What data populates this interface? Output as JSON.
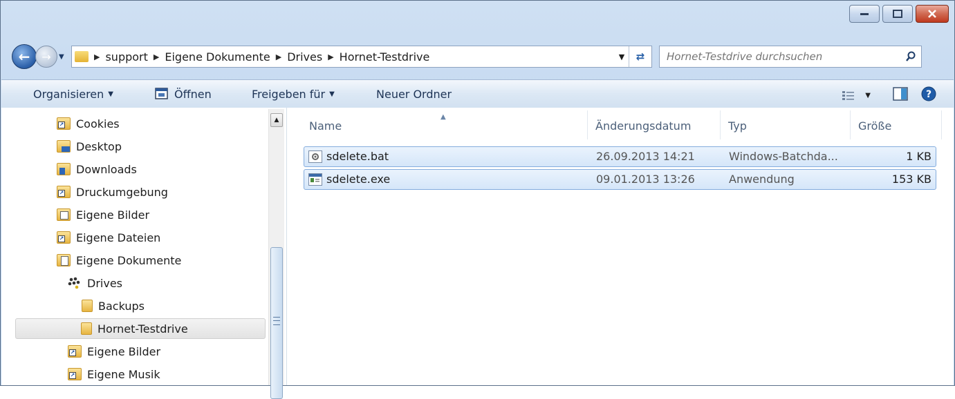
{
  "address": {
    "crumbs": [
      "support",
      "Eigene Dokumente",
      "Drives",
      "Hornet-Testdrive"
    ]
  },
  "search": {
    "placeholder": "Hornet-Testdrive durchsuchen"
  },
  "toolbar": {
    "organize": "Organisieren",
    "open": "Öffnen",
    "share": "Freigeben für",
    "new_folder": "Neuer Ordner"
  },
  "tree": [
    {
      "label": "Cookies"
    },
    {
      "label": "Desktop"
    },
    {
      "label": "Downloads"
    },
    {
      "label": "Druckumgebung"
    },
    {
      "label": "Eigene Bilder"
    },
    {
      "label": "Eigene Dateien"
    },
    {
      "label": "Eigene Dokumente"
    },
    {
      "label": "Drives"
    },
    {
      "label": "Backups"
    },
    {
      "label": "Hornet-Testdrive"
    },
    {
      "label": "Eigene Bilder"
    },
    {
      "label": "Eigene Musik"
    }
  ],
  "columns": {
    "name": "Name",
    "date": "Änderungsdatum",
    "type": "Typ",
    "size": "Größe"
  },
  "files": [
    {
      "name": "sdelete.bat",
      "date": "26.09.2013 14:21",
      "type": "Windows-Batchda...",
      "size": "1 KB"
    },
    {
      "name": "sdelete.exe",
      "date": "09.01.2013 13:26",
      "type": "Anwendung",
      "size": "153 KB"
    }
  ]
}
